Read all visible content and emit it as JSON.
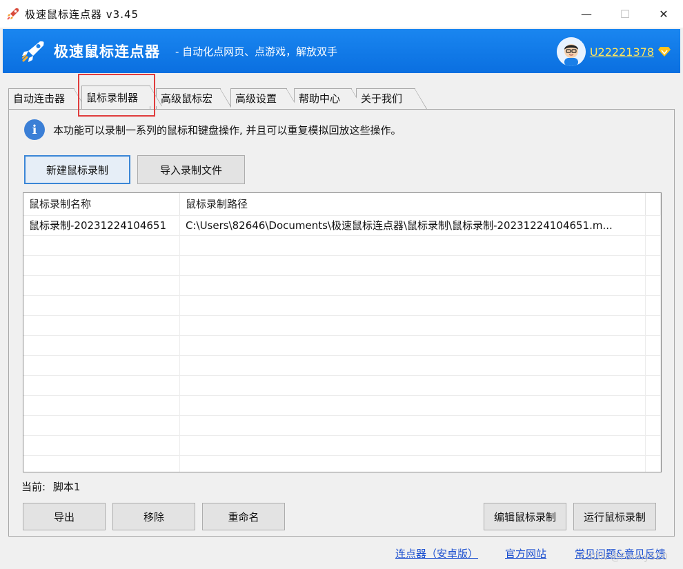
{
  "window": {
    "title": "极速鼠标连点器 v3.45",
    "minimize_glyph": "—",
    "maximize_glyph": "☐",
    "close_glyph": "✕"
  },
  "header": {
    "brand": "极速鼠标连点器",
    "slogan": "- 自动化点网页、点游戏，解放双手",
    "username": "U22221378",
    "accent_color": "#0a6fe0",
    "username_color": "#ffe55c"
  },
  "tabs": [
    {
      "label": "自动连击器"
    },
    {
      "label": "鼠标录制器"
    },
    {
      "label": "高级鼠标宏"
    },
    {
      "label": "高级设置"
    },
    {
      "label": "帮助中心"
    },
    {
      "label": "关于我们"
    }
  ],
  "active_tab": "鼠标录制器",
  "info": {
    "text": "本功能可以录制一系列的鼠标和键盘操作, 并且可以重复模拟回放这些操作。"
  },
  "actions": {
    "new_recording": "新建鼠标录制",
    "import_file": "导入录制文件"
  },
  "table": {
    "columns": [
      "鼠标录制名称",
      "鼠标录制路径"
    ],
    "rows": [
      {
        "name": "鼠标录制-20231224104651",
        "path": "C:\\Users\\82646\\Documents\\极速鼠标连点器\\鼠标录制\\鼠标录制-20231224104651.m..."
      }
    ]
  },
  "current": {
    "label": "当前:",
    "value": "脚本1"
  },
  "bottom_buttons": {
    "export": "导出",
    "remove": "移除",
    "rename": "重命名",
    "edit": "编辑鼠标录制",
    "run": "运行鼠标录制"
  },
  "footer": {
    "android": "连点器（安卓版）",
    "website": "官方网站",
    "faq": "常见问题&意见反馈"
  },
  "watermark": "CSDN @Funny520"
}
